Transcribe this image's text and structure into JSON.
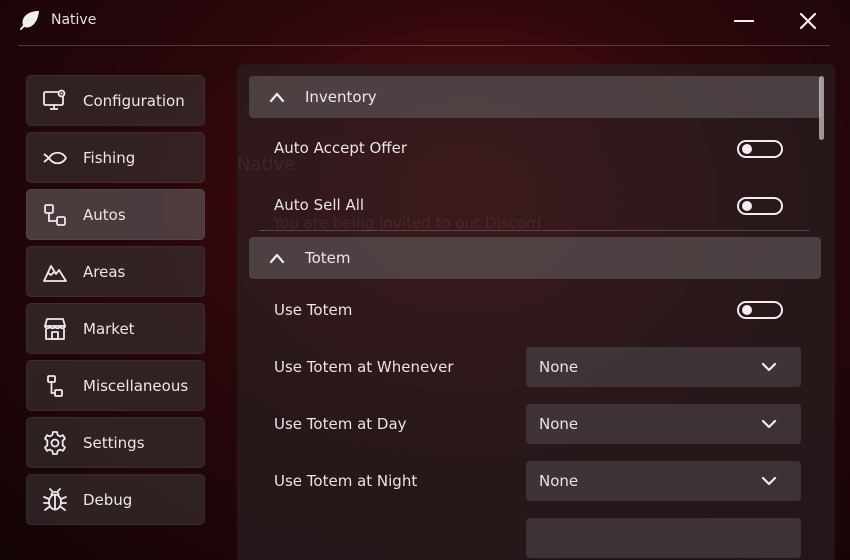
{
  "app": {
    "title": "Native"
  },
  "titlebar": {
    "logo_icon": "leaf-icon",
    "minimize_icon": "minimize-icon",
    "close_icon": "close-icon"
  },
  "sidebar": {
    "items": [
      {
        "label": "Configuration",
        "icon": "monitor-gear-icon"
      },
      {
        "label": "Fishing",
        "icon": "fish-icon"
      },
      {
        "label": "Autos",
        "icon": "nodes-icon",
        "active": true
      },
      {
        "label": "Areas",
        "icon": "mountain-icon"
      },
      {
        "label": "Market",
        "icon": "store-icon"
      },
      {
        "label": "Miscellaneous",
        "icon": "flow-icon"
      },
      {
        "label": "Settings",
        "icon": "gear-icon"
      },
      {
        "label": "Debug",
        "icon": "bug-icon"
      }
    ]
  },
  "content": {
    "background_overlay": {
      "title": "Native",
      "message": "You are being invited to our Discord"
    },
    "sections": [
      {
        "title": "Inventory",
        "expanded": true,
        "rows": [
          {
            "label": "Auto Accept Offer",
            "type": "toggle",
            "on": false
          },
          {
            "label": "Auto Sell All",
            "type": "toggle",
            "on": false
          }
        ]
      },
      {
        "title": "Totem",
        "expanded": true,
        "rows": [
          {
            "label": "Use Totem",
            "type": "toggle",
            "on": false
          },
          {
            "label": "Use Totem at Whenever",
            "type": "select",
            "value": "None"
          },
          {
            "label": "Use Totem at Day",
            "type": "select",
            "value": "None"
          },
          {
            "label": "Use Totem at Night",
            "type": "select",
            "value": "None"
          }
        ]
      }
    ]
  },
  "colors": {
    "accent": "#5a0d14",
    "panel": "#2a2224",
    "text": "#e9e4e5"
  }
}
